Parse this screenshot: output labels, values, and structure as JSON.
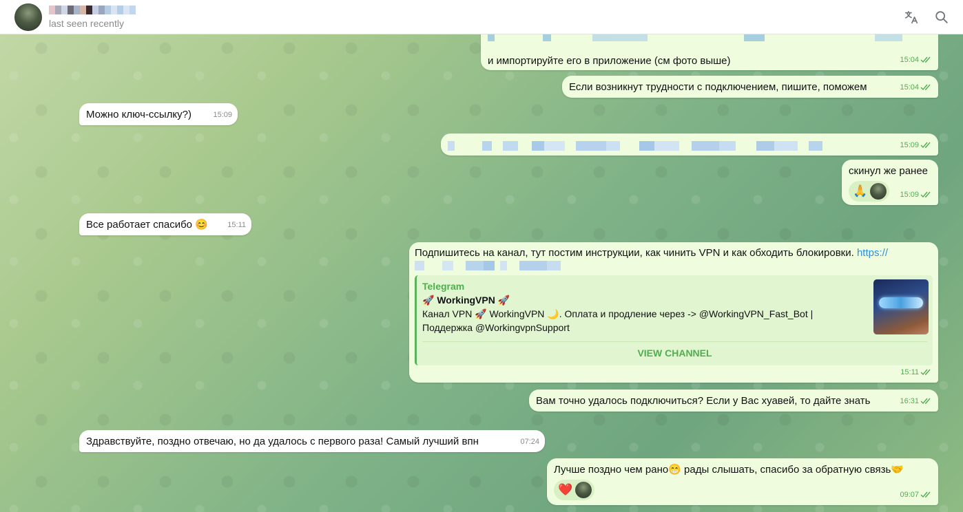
{
  "header": {
    "status": "last seen recently",
    "icons": [
      "translate-icon",
      "search-icon"
    ]
  },
  "messages": [
    {
      "dir": "out",
      "text": "и импортируйте его в приложение (см фото выше)",
      "time": "15:04"
    },
    {
      "dir": "out",
      "text": "Если возникнут трудности с подключением, пишите, поможем",
      "time": "15:04"
    },
    {
      "dir": "in",
      "text": "Можно ключ-ссылку?)",
      "time": "15:09"
    },
    {
      "dir": "out",
      "text": "",
      "time": "15:09"
    },
    {
      "dir": "out",
      "text": "скинул же ранее",
      "time": "15:09",
      "reaction": "🙏"
    },
    {
      "dir": "in",
      "text": "Все работает спасибо 😊",
      "time": "15:11"
    },
    {
      "dir": "out",
      "text": "Подпишитесь на канал, тут постим инструкции, как чинить VPN и как обходить блокировки.",
      "link": "https://",
      "time": "15:11"
    },
    {
      "dir": "out",
      "text": "Вам точно удалось подключиться? Если у Вас хуавей, то дайте знать",
      "time": "16:31"
    },
    {
      "dir": "in",
      "text": "Здравствуйте, поздно отвечаю, но да удалось с первого раза! Самый лучший впн",
      "time": "07:24"
    },
    {
      "dir": "out",
      "text": "Лучше поздно чем рано😁 рады слышать, спасибо за обратную связь🤝",
      "time": "09:07",
      "reaction": "❤️"
    }
  ],
  "preview": {
    "site": "Telegram",
    "title": "🚀 WorkingVPN 🚀",
    "description": "Канал VPN 🚀 WorkingVPN 🌙. Оплата и продление через -> @WorkingVPN_Fast_Bot | Поддержка @WorkingvpnSupport",
    "button": "VIEW CHANNEL"
  },
  "colors": {
    "out_bubble": "#effdde",
    "in_bubble": "#ffffff",
    "accent_green": "#4fae4e",
    "link": "#2f8fd8"
  }
}
